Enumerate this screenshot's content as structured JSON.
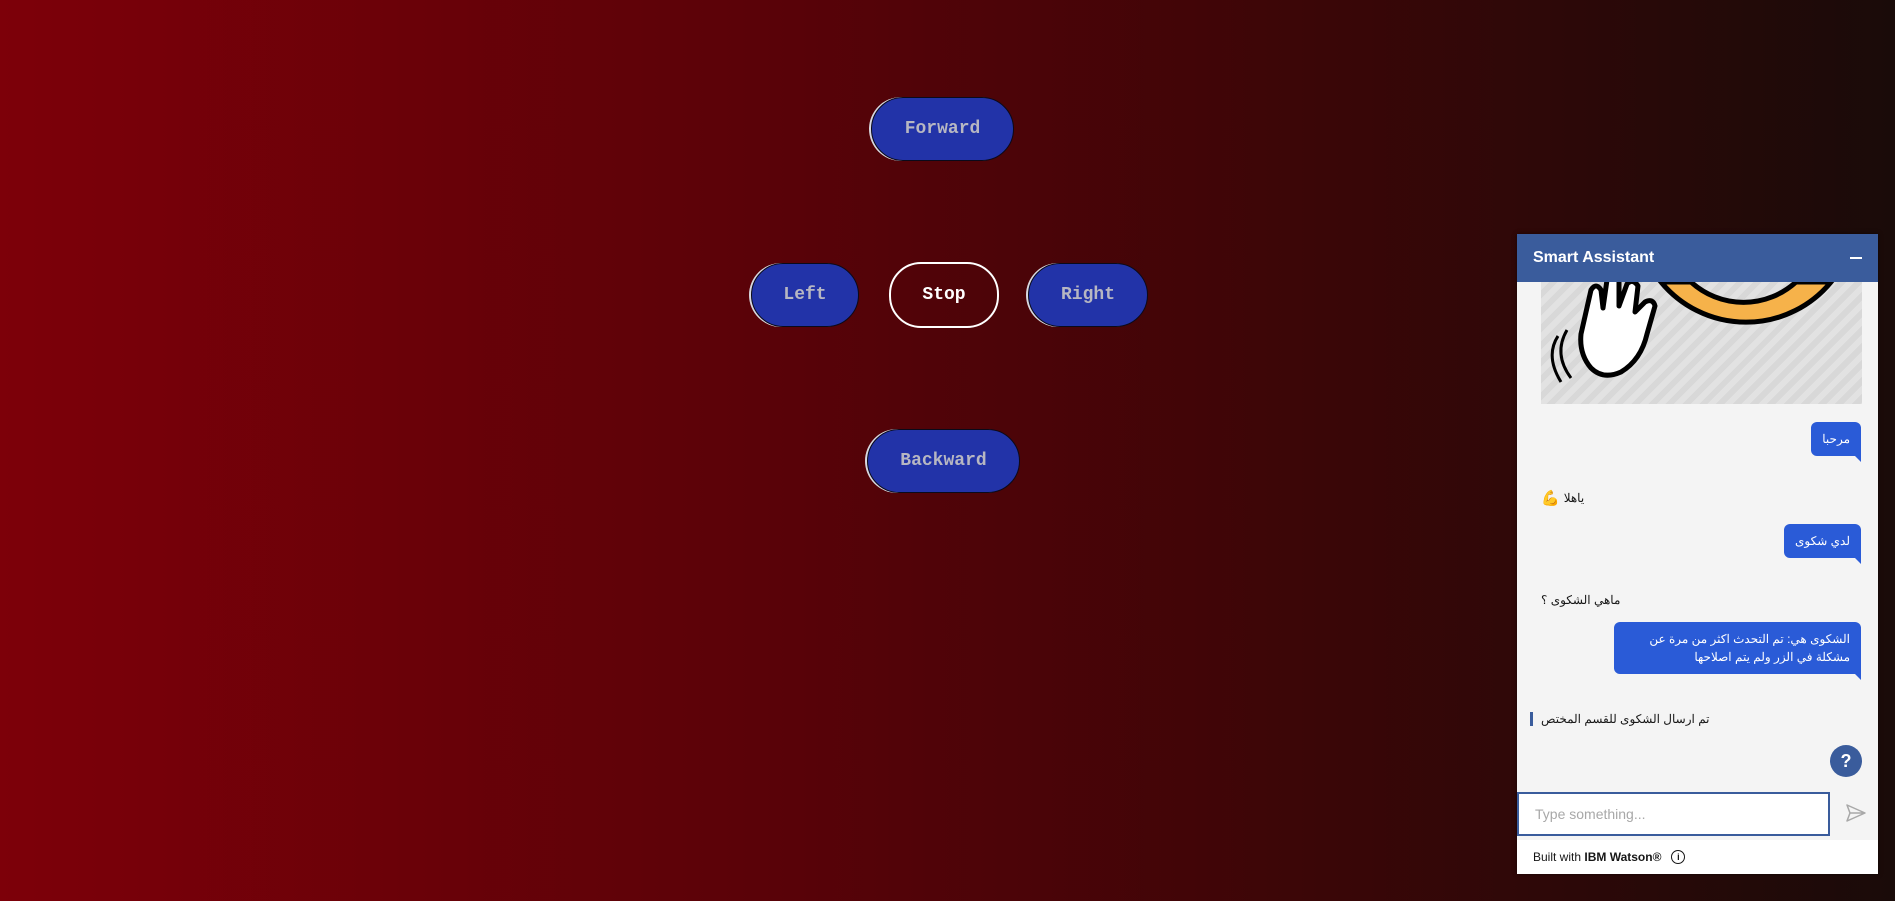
{
  "controls": {
    "forward": "Forward",
    "left": "Left",
    "stop": "Stop",
    "right": "Right",
    "backward": "Backward"
  },
  "chat": {
    "title": "Smart Assistant",
    "messages": {
      "user1": "مرحبا",
      "bot1": "ياهلا",
      "user2": "لدي شكوى",
      "bot2": "ماهي الشكوى ؟",
      "user3": "الشكوى هي: تم التحدث اكثر من مرة عن مشكلة في الزر ولم يتم اصلاحها",
      "bot3": "تم ارسال الشكوى للقسم المختص"
    },
    "input_placeholder": "Type something...",
    "footer_prefix": "Built with",
    "footer_brand": "IBM Watson®",
    "help_glyph": "?"
  },
  "colors": {
    "button_blue": "#2233a8",
    "chat_header": "#3a5c9c",
    "user_bubble": "#2a5bd7",
    "hero_hand_orange": "#f6b24a"
  }
}
